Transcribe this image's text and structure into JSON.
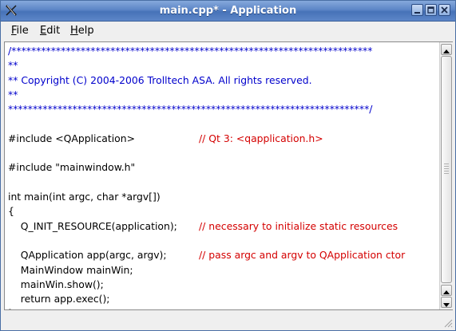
{
  "window": {
    "title": "main.cpp* - Application",
    "buttons": [
      "minimize",
      "maximize",
      "close"
    ],
    "icon": "x-app-icon"
  },
  "menubar": {
    "file": {
      "mnemonic": "F",
      "rest": "ile"
    },
    "edit": {
      "mnemonic": "E",
      "rest": "dit"
    },
    "help": {
      "mnemonic": "H",
      "rest": "elp"
    }
  },
  "editor": {
    "lines": [
      {
        "code": "/*************************************************************************",
        "comment": "",
        "color": "#0000cc"
      },
      {
        "code": "**",
        "comment": "",
        "color": "#0000cc"
      },
      {
        "code": "** Copyright (C) 2004-2006 Trolltech ASA. All rights reserved.",
        "comment": "",
        "color": "#0000cc"
      },
      {
        "code": "**",
        "comment": "",
        "color": "#0000cc"
      },
      {
        "code": "*************************************************************************/",
        "comment": "",
        "color": "#0000cc"
      },
      {
        "code": "",
        "comment": ""
      },
      {
        "code": "#include <QApplication>",
        "comment": "// Qt 3: <qapplication.h>"
      },
      {
        "code": "",
        "comment": ""
      },
      {
        "code": "#include \"mainwindow.h\"",
        "comment": ""
      },
      {
        "code": "",
        "comment": ""
      },
      {
        "code": "int main(int argc, char *argv[])",
        "comment": ""
      },
      {
        "code": "{",
        "comment": ""
      },
      {
        "code": "    Q_INIT_RESOURCE(application);",
        "comment": "// necessary to initialize static resources"
      },
      {
        "code": "",
        "comment": ""
      },
      {
        "code": "    QApplication app(argc, argv);",
        "comment": "// pass argc and argv to QApplication ctor"
      },
      {
        "code": "    MainWindow mainWin;",
        "comment": ""
      },
      {
        "code": "    mainWin.show();",
        "comment": ""
      },
      {
        "code": "    return app.exec();",
        "comment": ""
      },
      {
        "code": "}",
        "comment": ""
      }
    ]
  },
  "colors": {
    "comment_blue": "#0000cc",
    "comment_red": "#d40000",
    "titlebar": "#5c85c6"
  }
}
